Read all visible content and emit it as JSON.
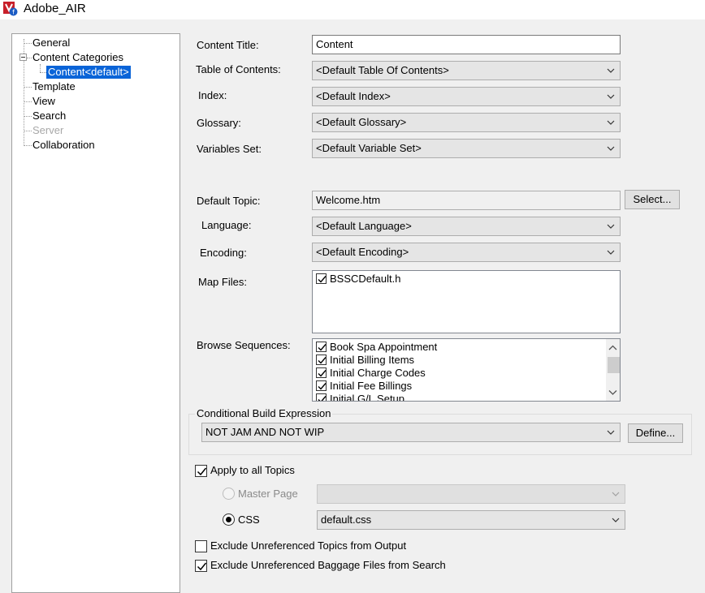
{
  "window": {
    "title": "Adobe_AIR"
  },
  "tree": {
    "items": [
      {
        "label": "General"
      },
      {
        "label": "Content Categories"
      },
      {
        "label": "Content<default>"
      },
      {
        "label": "Template"
      },
      {
        "label": "View"
      },
      {
        "label": "Search"
      },
      {
        "label": "Server"
      },
      {
        "label": "Collaboration"
      }
    ]
  },
  "form": {
    "content_title_label": "Content Title:",
    "content_title_value": "Content",
    "toc_label": "Table of Contents:",
    "toc_value": "<Default Table Of Contents>",
    "index_label": "Index:",
    "index_value": "<Default Index>",
    "glossary_label": "Glossary:",
    "glossary_value": "<Default Glossary>",
    "variables_label": "Variables Set:",
    "variables_value": "<Default Variable Set>",
    "default_topic_label": "Default Topic:",
    "default_topic_value": "Welcome.htm",
    "select_button": "Select...",
    "language_label": "Language:",
    "language_value": "<Default Language>",
    "encoding_label": "Encoding:",
    "encoding_value": "<Default Encoding>",
    "map_files_label": "Map Files:",
    "map_files": [
      {
        "label": "BSSCDefault.h",
        "checked": true
      }
    ],
    "browse_label": "Browse Sequences:",
    "browse_sequences": [
      {
        "label": "Book Spa Appointment",
        "checked": true
      },
      {
        "label": "Initial Billing Items",
        "checked": true
      },
      {
        "label": "Initial Charge Codes",
        "checked": true
      },
      {
        "label": "Initial Fee Billings",
        "checked": true
      },
      {
        "label": "Initial G/L Setup",
        "checked": true
      }
    ],
    "cond_group_label": "Conditional Build Expression",
    "cond_value": "NOT JAM AND NOT WIP",
    "define_button": "Define...",
    "apply_all_label": "Apply to all Topics",
    "apply_all_checked": true,
    "master_page_label": "Master Page",
    "master_page_value": "",
    "css_label": "CSS",
    "css_value": "default.css",
    "exclude_topics_label": "Exclude Unreferenced Topics from Output",
    "exclude_topics_checked": false,
    "exclude_baggage_label": "Exclude Unreferenced Baggage Files from Search",
    "exclude_baggage_checked": true
  },
  "colors": {
    "selection": "#0a64d8",
    "icon_red": "#c8202a",
    "icon_blue": "#1c5cc4"
  },
  "icons": {
    "app": "adobe-air-app-icon",
    "dropdown": "chevron-down-icon",
    "check": "checkmark-icon"
  }
}
